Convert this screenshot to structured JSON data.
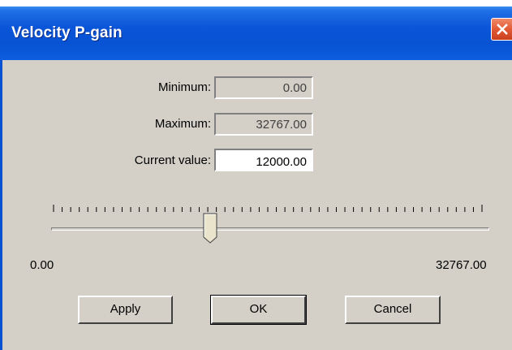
{
  "window": {
    "title": "Velocity P-gain"
  },
  "fields": {
    "minimum_label": "Minimum:",
    "minimum_value": "0.00",
    "maximum_label": "Maximum:",
    "maximum_value": "32767.00",
    "current_label": "Current value:",
    "current_value": "12000.00"
  },
  "slider": {
    "min_label": "0.00",
    "max_label": "32767.00",
    "min": 0,
    "max": 32767,
    "value": 12000,
    "tick_count": 50
  },
  "buttons": {
    "apply": "Apply",
    "ok": "OK",
    "cancel": "Cancel"
  },
  "colors": {
    "titlebar": "#0853d3",
    "close_button": "#e25a34",
    "dialog_face": "#d4d0c8"
  }
}
